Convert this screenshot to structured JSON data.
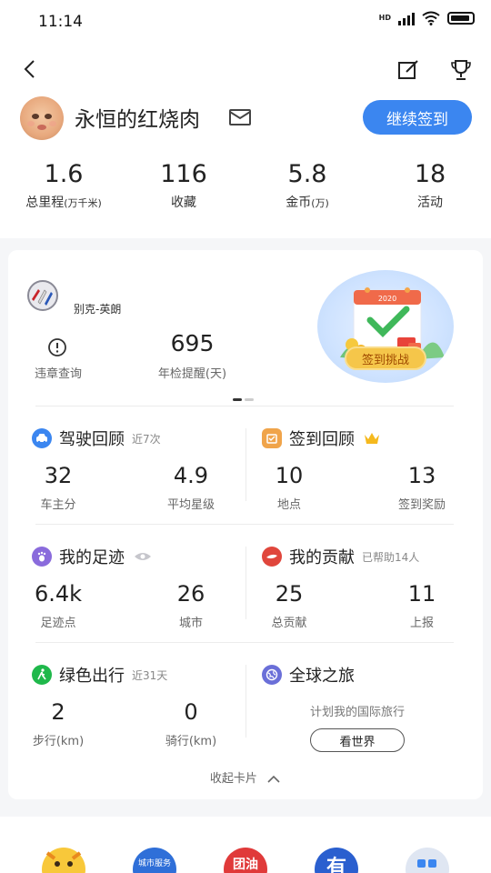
{
  "status": {
    "time": "11:14",
    "hd": "HD"
  },
  "user": {
    "name": "永恒的红烧肉",
    "checkin_label": "继续签到"
  },
  "stats": [
    {
      "value": "1.6",
      "label": "总里程",
      "unit": "(万千米)"
    },
    {
      "value": "116",
      "label": "收藏",
      "unit": ""
    },
    {
      "value": "5.8",
      "label": "金币",
      "unit": "(万)"
    },
    {
      "value": "18",
      "label": "活动",
      "unit": ""
    }
  ],
  "car": {
    "name": "别克-英朗",
    "violation_label": "违章查询",
    "inspection_value": "695",
    "inspection_label": "年检提醒(天)",
    "challenge_label": "签到挑战",
    "challenge_year": "2020"
  },
  "driving": {
    "title": "驾驶回顾",
    "sub": "近7次",
    "a_value": "32",
    "a_label": "车主分",
    "b_value": "4.9",
    "b_label": "平均星级"
  },
  "checkin_review": {
    "title": "签到回顾",
    "a_value": "10",
    "a_label": "地点",
    "b_value": "13",
    "b_label": "签到奖励"
  },
  "footprint": {
    "title": "我的足迹",
    "a_value": "6.4k",
    "a_label": "足迹点",
    "b_value": "26",
    "b_label": "城市"
  },
  "contribution": {
    "title": "我的贡献",
    "sub": "已帮助14人",
    "a_value": "25",
    "a_label": "总贡献",
    "b_value": "11",
    "b_label": "上报"
  },
  "green": {
    "title": "绿色出行",
    "sub": "近31天",
    "a_value": "2",
    "a_label": "步行(km)",
    "b_value": "0",
    "b_label": "骑行(km)"
  },
  "global": {
    "title": "全球之旅",
    "plan": "计划我的国际旅行",
    "button": "看世界"
  },
  "collapse_label": "收起卡片",
  "bottom": {
    "city_service": "城市服务",
    "fuel": "团油",
    "you": "有"
  },
  "colors": {
    "accent": "#3b86f0",
    "driving": "#3b86f0",
    "checkin": "#f0a44a",
    "footprint": "#8a6bdc",
    "contribution": "#e0463c",
    "green": "#1fb84b",
    "global": "#6a6fd8"
  }
}
